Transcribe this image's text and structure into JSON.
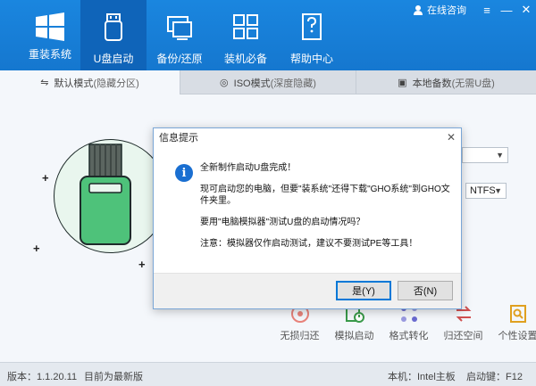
{
  "header": {
    "logo_label": "重装系统",
    "nav": [
      {
        "label": "U盘启动",
        "icon": "usb-drive-icon",
        "active": true
      },
      {
        "label": "备份/还原",
        "icon": "backup-restore-icon",
        "active": false
      },
      {
        "label": "装机必备",
        "icon": "apps-grid-icon",
        "active": false
      },
      {
        "label": "帮助中心",
        "icon": "help-document-icon",
        "active": false
      }
    ],
    "consult_label": "在线咨询"
  },
  "tabs": [
    {
      "label": "默认模式",
      "hint": "(隐藏分区)",
      "icon": "usb-symbol-icon"
    },
    {
      "label": "ISO模式",
      "hint": "(深度隐藏)",
      "icon": "disc-icon"
    },
    {
      "label": "本地备数",
      "hint": "(无需U盘)",
      "icon": "local-disk-icon"
    }
  ],
  "main": {
    "fs_select_value": "NTFS"
  },
  "tools": [
    {
      "label": "无损归还",
      "icon": "restore-icon"
    },
    {
      "label": "模拟启动",
      "icon": "simulate-boot-icon"
    },
    {
      "label": "格式转化",
      "icon": "format-convert-icon"
    },
    {
      "label": "归还空间",
      "icon": "return-space-icon"
    },
    {
      "label": "个性设置",
      "icon": "personalize-icon"
    }
  ],
  "status": {
    "version": "版本：1.1.20.11",
    "latest": "目前为最新版",
    "board": "本机：Intel主板",
    "boot_key": "启动键：F12"
  },
  "dialog": {
    "title": "信息提示",
    "line1": "全新制作启动U盘完成！",
    "line2": "现可启动您的电脑，但要\"装系统\"还得下载\"GHO系统\"到GHO文件夹里。",
    "line3": "要用\"电脑模拟器\"测试U盘的启动情况吗？",
    "line4": "注意：模拟器仅作启动测试，建议不要测试PE等工具！",
    "yes_label": "是(Y)",
    "no_label": "否(N)"
  },
  "colors": {
    "header_blue": "#1577cf",
    "nav_active": "#0f64b9",
    "illustration_green": "#4ec27a"
  }
}
